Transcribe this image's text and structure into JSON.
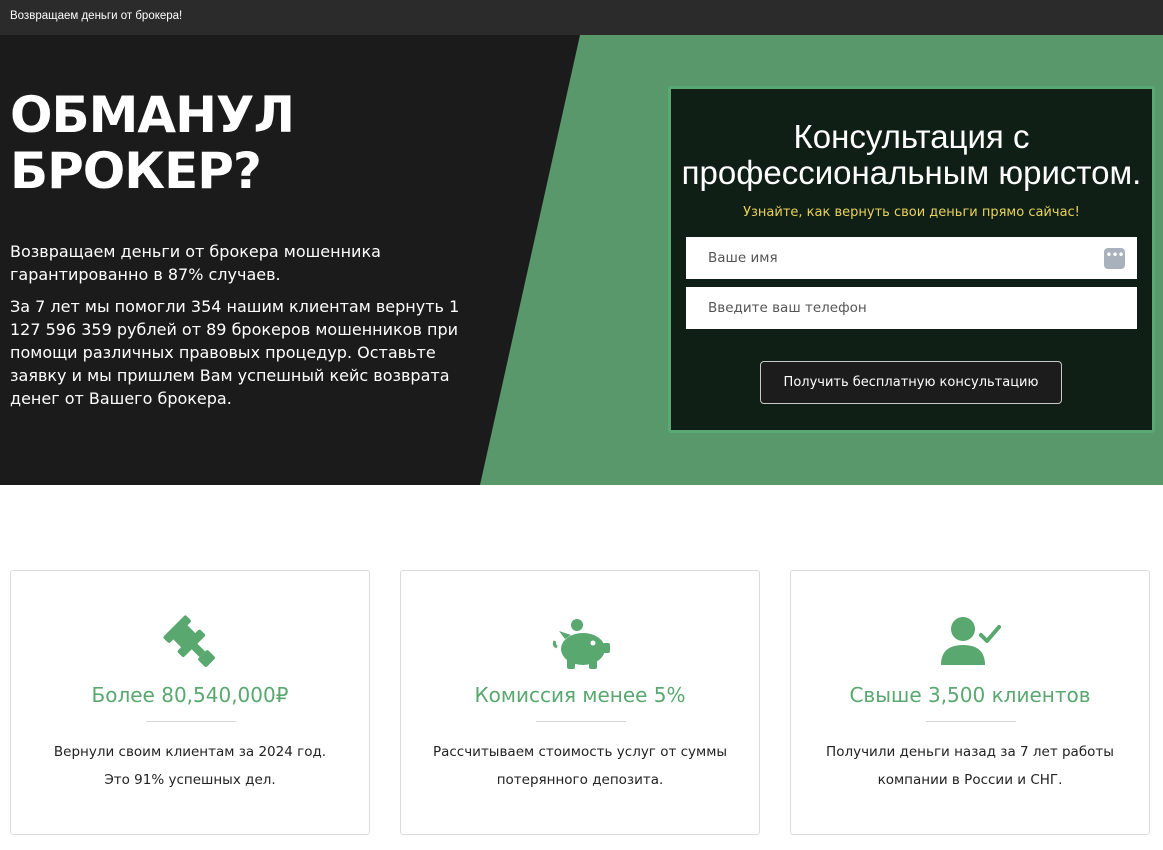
{
  "topbar": {
    "text": "Возвращаем деньги от брокера!"
  },
  "hero": {
    "title": "ОБМАНУЛ\nБРОКЕР?",
    "lead": "Возвращаем деньги от брокера мошенника гарантированно в 87% случаев.",
    "body": "За 7 лет мы помогли 354 нашим клиентам вернуть 1 127 596 359 рублей от 89 брокеров мошенников при помощи различных правовых процедур. Оставьте заявку и мы пришлем Вам успешный кейс возврата денег от Вашего брокера."
  },
  "form": {
    "title": "Консультация с\nпрофессиональным юристом.",
    "subtitle": "Узнайте, как вернуть свои деньги прямо сайчас!",
    "name_placeholder": "Ваше имя",
    "phone_placeholder": "Введите ваш телефон",
    "submit_label": "Получить бесплатную консультацию"
  },
  "cards": [
    {
      "icon": "gavel-icon",
      "title": "Более 80,540,000₽",
      "text": "Вернули своим клиентам за 2024 год. Это 91% успешных дел."
    },
    {
      "icon": "piggy-bank-icon",
      "title": "Комиссия менее 5%",
      "text": "Рассчитываем стоимость услуг от суммы потерянного депозита."
    },
    {
      "icon": "user-check-icon",
      "title": "Свыше 3,500 клиентов",
      "text": "Получили деньги назад за 7 лет работы компании в России и СНГ."
    }
  ],
  "colors": {
    "accent_green": "#58986b",
    "dark_bg": "#1b1b1b",
    "form_bg": "#0f1f16",
    "subtitle_yellow": "#e9d25a",
    "card_title_green": "#58a870"
  }
}
